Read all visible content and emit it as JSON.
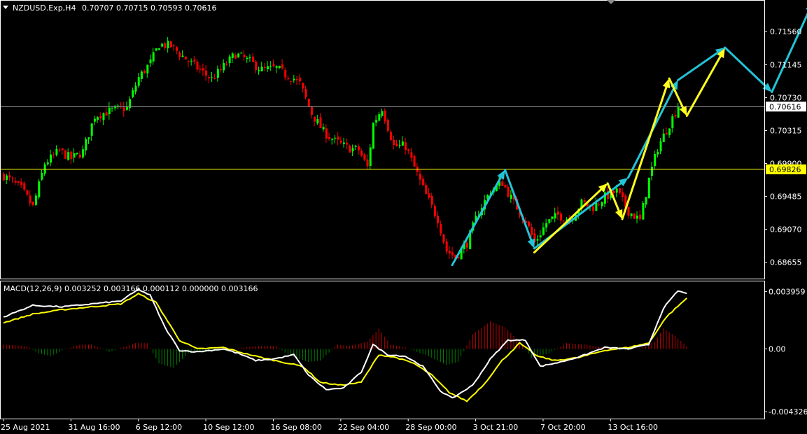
{
  "header": {
    "symbol": "NZDUSD.Exp,H4",
    "ohlc": "0.70707 0.70715 0.70593 0.70616",
    "macd_label": "MACD(12,26,9) 0.003252 0.003166 0.000112 0.000000 0.003166"
  },
  "colors": {
    "background": "#000000",
    "bull": "#00ff00",
    "bear": "#ff0000",
    "axis": "#ffffff",
    "hline": "#ffff00",
    "cyan_arrow": "#22c4d8",
    "yellow_arrow": "#ffff1f",
    "macd_line": "#ffffff",
    "signal_line": "#ffff00",
    "hist_pos": "#c00000",
    "hist_neg": "#008000"
  },
  "chart_data": [
    {
      "type": "candlestick",
      "title": "NZDUSD.Exp,H4",
      "ylim": [
        0.6845,
        0.7195
      ],
      "y_ticks": [
        "0.71560",
        "0.71145",
        "0.70730",
        "0.70315",
        "0.69900",
        "0.69485",
        "0.69070",
        "0.68655"
      ],
      "current_price": "0.70616",
      "horizontal_level": "0.69826",
      "x_ticks": [
        "25 Aug 2021",
        "31 Aug 16:00",
        "6 Sep 12:00",
        "10 Sep 12:00",
        "16 Sep 08:00",
        "22 Sep 04:00",
        "28 Sep 00:00",
        "3 Oct 21:00",
        "7 Oct 20:00",
        "13 Oct 16:00"
      ],
      "close_path": [
        [
          0,
          0.6975
        ],
        [
          6,
          0.6958
        ],
        [
          10,
          0.6935
        ],
        [
          14,
          0.699
        ],
        [
          19,
          0.7006
        ],
        [
          23,
          0.6996
        ],
        [
          27,
          0.7005
        ],
        [
          31,
          0.705
        ],
        [
          37,
          0.7057
        ],
        [
          42,
          0.706
        ],
        [
          46,
          0.7098
        ],
        [
          50,
          0.7117
        ],
        [
          53,
          0.714
        ],
        [
          57,
          0.7138
        ],
        [
          61,
          0.7125
        ],
        [
          66,
          0.711
        ],
        [
          71,
          0.7096
        ],
        [
          75,
          0.7112
        ],
        [
          79,
          0.7128
        ],
        [
          84,
          0.7118
        ],
        [
          88,
          0.7108
        ],
        [
          93,
          0.711
        ],
        [
          96,
          0.7102
        ],
        [
          99,
          0.7097
        ],
        [
          101,
          0.709
        ],
        [
          105,
          0.7053
        ],
        [
          109,
          0.703
        ],
        [
          113,
          0.7018
        ],
        [
          117,
          0.701
        ],
        [
          121,
          0.7007
        ],
        [
          124,
          0.6985
        ],
        [
          126,
          0.704
        ],
        [
          129,
          0.706
        ],
        [
          133,
          0.7012
        ],
        [
          137,
          0.7012
        ],
        [
          140,
          0.6985
        ],
        [
          144,
          0.695
        ],
        [
          148,
          0.692
        ],
        [
          151,
          0.688
        ],
        [
          154,
          0.6872
        ],
        [
          158,
          0.689
        ],
        [
          162,
          0.693
        ],
        [
          166,
          0.6955
        ],
        [
          170,
          0.6966
        ],
        [
          174,
          0.694
        ],
        [
          178,
          0.6918
        ],
        [
          181,
          0.689
        ],
        [
          185,
          0.6915
        ],
        [
          189,
          0.6925
        ],
        [
          193,
          0.692
        ],
        [
          197,
          0.694
        ],
        [
          201,
          0.6935
        ],
        [
          205,
          0.6948
        ],
        [
          209,
          0.6955
        ],
        [
          213,
          0.693
        ],
        [
          217,
          0.6918
        ],
        [
          220,
          0.697
        ],
        [
          223,
          0.701
        ],
        [
          227,
          0.704
        ],
        [
          230,
          0.7062
        ]
      ],
      "cyan_arrow_path": [
        [
          0.6862,
          153
        ],
        [
          0.6982,
          171
        ],
        [
          0.6883,
          181
        ],
        [
          0.6972,
          213
        ],
        [
          0.7095,
          230
        ],
        [
          0.7136,
          246
        ],
        [
          0.708,
          262
        ],
        [
          0.7193,
          276
        ]
      ],
      "yellow_arrow_path": [
        [
          0.6878,
          181
        ],
        [
          0.6965,
          206
        ],
        [
          0.692,
          211
        ],
        [
          0.7097,
          227
        ],
        [
          0.705,
          233
        ],
        [
          0.7135,
          246
        ]
      ]
    },
    {
      "type": "macd",
      "title": "MACD(12,26,9)",
      "ylim": [
        -0.0048,
        0.0047
      ],
      "y_ticks": [
        "0.003959",
        "0.00",
        "-0.004326"
      ],
      "macd_path": [
        [
          0,
          0.0022
        ],
        [
          10,
          0.003
        ],
        [
          20,
          0.0029
        ],
        [
          30,
          0.0031
        ],
        [
          40,
          0.0033
        ],
        [
          46,
          0.0041
        ],
        [
          50,
          0.0037
        ],
        [
          55,
          0.0015
        ],
        [
          60,
          -0.0001
        ],
        [
          66,
          -0.0002
        ],
        [
          75,
          0.0
        ],
        [
          80,
          -0.0003
        ],
        [
          86,
          -0.0008
        ],
        [
          92,
          -0.0007
        ],
        [
          99,
          -0.0004
        ],
        [
          104,
          -0.0018
        ],
        [
          110,
          -0.0028
        ],
        [
          116,
          -0.0027
        ],
        [
          122,
          -0.0016
        ],
        [
          126,
          0.0003
        ],
        [
          131,
          -0.0004
        ],
        [
          137,
          -0.0005
        ],
        [
          143,
          -0.0012
        ],
        [
          149,
          -0.0029
        ],
        [
          153,
          -0.0034
        ],
        [
          160,
          -0.0025
        ],
        [
          166,
          -0.0007
        ],
        [
          172,
          0.0006
        ],
        [
          178,
          0.0006
        ],
        [
          183,
          -0.0012
        ],
        [
          190,
          -0.0009
        ],
        [
          197,
          -0.0005
        ],
        [
          205,
          0.0001
        ],
        [
          213,
          0.0
        ],
        [
          220,
          0.0003
        ],
        [
          225,
          0.0028
        ],
        [
          230,
          0.004
        ],
        [
          233,
          0.0038
        ]
      ],
      "signal_path": [
        [
          0,
          0.0018
        ],
        [
          10,
          0.0024
        ],
        [
          20,
          0.0027
        ],
        [
          30,
          0.0029
        ],
        [
          40,
          0.0031
        ],
        [
          46,
          0.0038
        ],
        [
          52,
          0.0032
        ],
        [
          60,
          0.0006
        ],
        [
          66,
          0.0
        ],
        [
          75,
          0.0001
        ],
        [
          82,
          -0.0003
        ],
        [
          88,
          -0.0006
        ],
        [
          95,
          -0.0009
        ],
        [
          102,
          -0.0012
        ],
        [
          108,
          -0.0023
        ],
        [
          115,
          -0.0025
        ],
        [
          122,
          -0.0023
        ],
        [
          128,
          -0.0004
        ],
        [
          134,
          -0.0006
        ],
        [
          140,
          -0.001
        ],
        [
          146,
          -0.0018
        ],
        [
          152,
          -0.003
        ],
        [
          158,
          -0.0036
        ],
        [
          164,
          -0.0024
        ],
        [
          170,
          -0.0008
        ],
        [
          176,
          0.0004
        ],
        [
          182,
          -0.0005
        ],
        [
          188,
          -0.0008
        ],
        [
          196,
          -0.0006
        ],
        [
          205,
          -0.0001
        ],
        [
          213,
          0.0001
        ],
        [
          220,
          0.0004
        ],
        [
          226,
          0.0022
        ],
        [
          233,
          0.0035
        ]
      ],
      "histogram_path": [
        [
          0,
          0.0003
        ],
        [
          8,
          0.0002
        ],
        [
          12,
          -0.0003
        ],
        [
          16,
          -0.0005
        ],
        [
          20,
          -0.0001
        ],
        [
          26,
          0.0003
        ],
        [
          30,
          0.0003
        ],
        [
          36,
          -0.0002
        ],
        [
          45,
          0.0004
        ],
        [
          49,
          0.0004
        ],
        [
          53,
          -0.001
        ],
        [
          58,
          -0.0013
        ],
        [
          63,
          -0.0003
        ],
        [
          70,
          -0.0002
        ],
        [
          78,
          0.0
        ],
        [
          86,
          0.0002
        ],
        [
          93,
          0.0002
        ],
        [
          97,
          -0.0004
        ],
        [
          101,
          -0.0007
        ],
        [
          104,
          -0.0009
        ],
        [
          108,
          -0.0008
        ],
        [
          114,
          0.0003
        ],
        [
          118,
          0.0002
        ],
        [
          124,
          0.0005
        ],
        [
          128,
          0.0014
        ],
        [
          132,
          0.0003
        ],
        [
          137,
          0.0001
        ],
        [
          145,
          -0.0005
        ],
        [
          151,
          -0.0011
        ],
        [
          155,
          -0.0009
        ],
        [
          160,
          0.001
        ],
        [
          166,
          0.0019
        ],
        [
          171,
          0.0015
        ],
        [
          176,
          0.0005
        ],
        [
          180,
          -0.0006
        ],
        [
          186,
          -0.0003
        ],
        [
          192,
          0.0004
        ],
        [
          198,
          0.0003
        ],
        [
          205,
          0.0001
        ],
        [
          213,
          -0.0001
        ],
        [
          218,
          0.0001
        ],
        [
          222,
          0.0005
        ],
        [
          225,
          0.0014
        ],
        [
          229,
          0.0009
        ],
        [
          233,
          0.0002
        ]
      ]
    }
  ]
}
